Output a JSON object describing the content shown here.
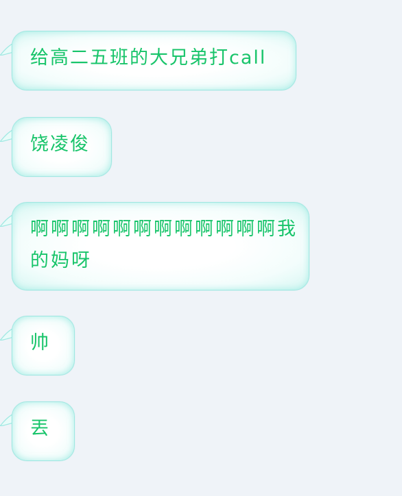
{
  "top_fragment": "——",
  "messages": [
    {
      "text": "给高二五班的大兄弟打call"
    },
    {
      "text": "饶凌俊"
    },
    {
      "text": "啊啊啊啊啊啊啊啊啊啊啊啊我的妈呀"
    },
    {
      "text": "帅"
    },
    {
      "text": "丟"
    }
  ],
  "colors": {
    "background": "#eff3f8",
    "bubble_border": "#9fe8e2",
    "text": "#18c46a"
  }
}
